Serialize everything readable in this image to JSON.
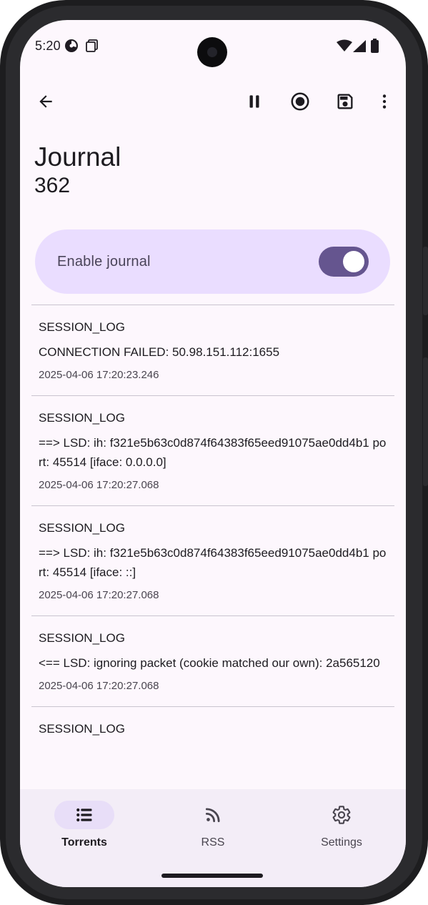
{
  "status_bar": {
    "time": "5:20"
  },
  "app_bar": {
    "back_icon": "arrow-back-icon",
    "actions": [
      "pause-icon",
      "record-icon",
      "save-icon",
      "more-vert-icon"
    ]
  },
  "header": {
    "title": "Journal",
    "count": "362"
  },
  "journal_toggle": {
    "label": "Enable journal",
    "enabled": true
  },
  "log_entries": [
    {
      "type": "SESSION_LOG",
      "message": "CONNECTION FAILED: 50.98.151.112:1655",
      "timestamp": "2025-04-06 17:20:23.246"
    },
    {
      "type": "SESSION_LOG",
      "message": "==> LSD: ih: f321e5b63c0d874f64383f65eed91075ae0dd4b1 port: 45514 [iface: 0.0.0.0]",
      "timestamp": "2025-04-06 17:20:27.068"
    },
    {
      "type": "SESSION_LOG",
      "message": "==> LSD: ih: f321e5b63c0d874f64383f65eed91075ae0dd4b1 port: 45514 [iface: ::]",
      "timestamp": "2025-04-06 17:20:27.068"
    },
    {
      "type": "SESSION_LOG",
      "message": "<== LSD: ignoring packet (cookie matched our own): 2a565120",
      "timestamp": "2025-04-06 17:20:27.068"
    },
    {
      "type": "SESSION_LOG",
      "message": "",
      "timestamp": ""
    }
  ],
  "bottom_nav": {
    "items": [
      {
        "label": "Torrents",
        "icon": "list-icon",
        "active": true
      },
      {
        "label": "RSS",
        "icon": "rss-icon",
        "active": false
      },
      {
        "label": "Settings",
        "icon": "settings-icon",
        "active": false
      }
    ]
  },
  "colors": {
    "background": "#fdf7fd",
    "accent": "#65558f",
    "card": "#eaddff",
    "nav_background": "#f3edf7",
    "nav_active_pill": "#e8def8"
  }
}
